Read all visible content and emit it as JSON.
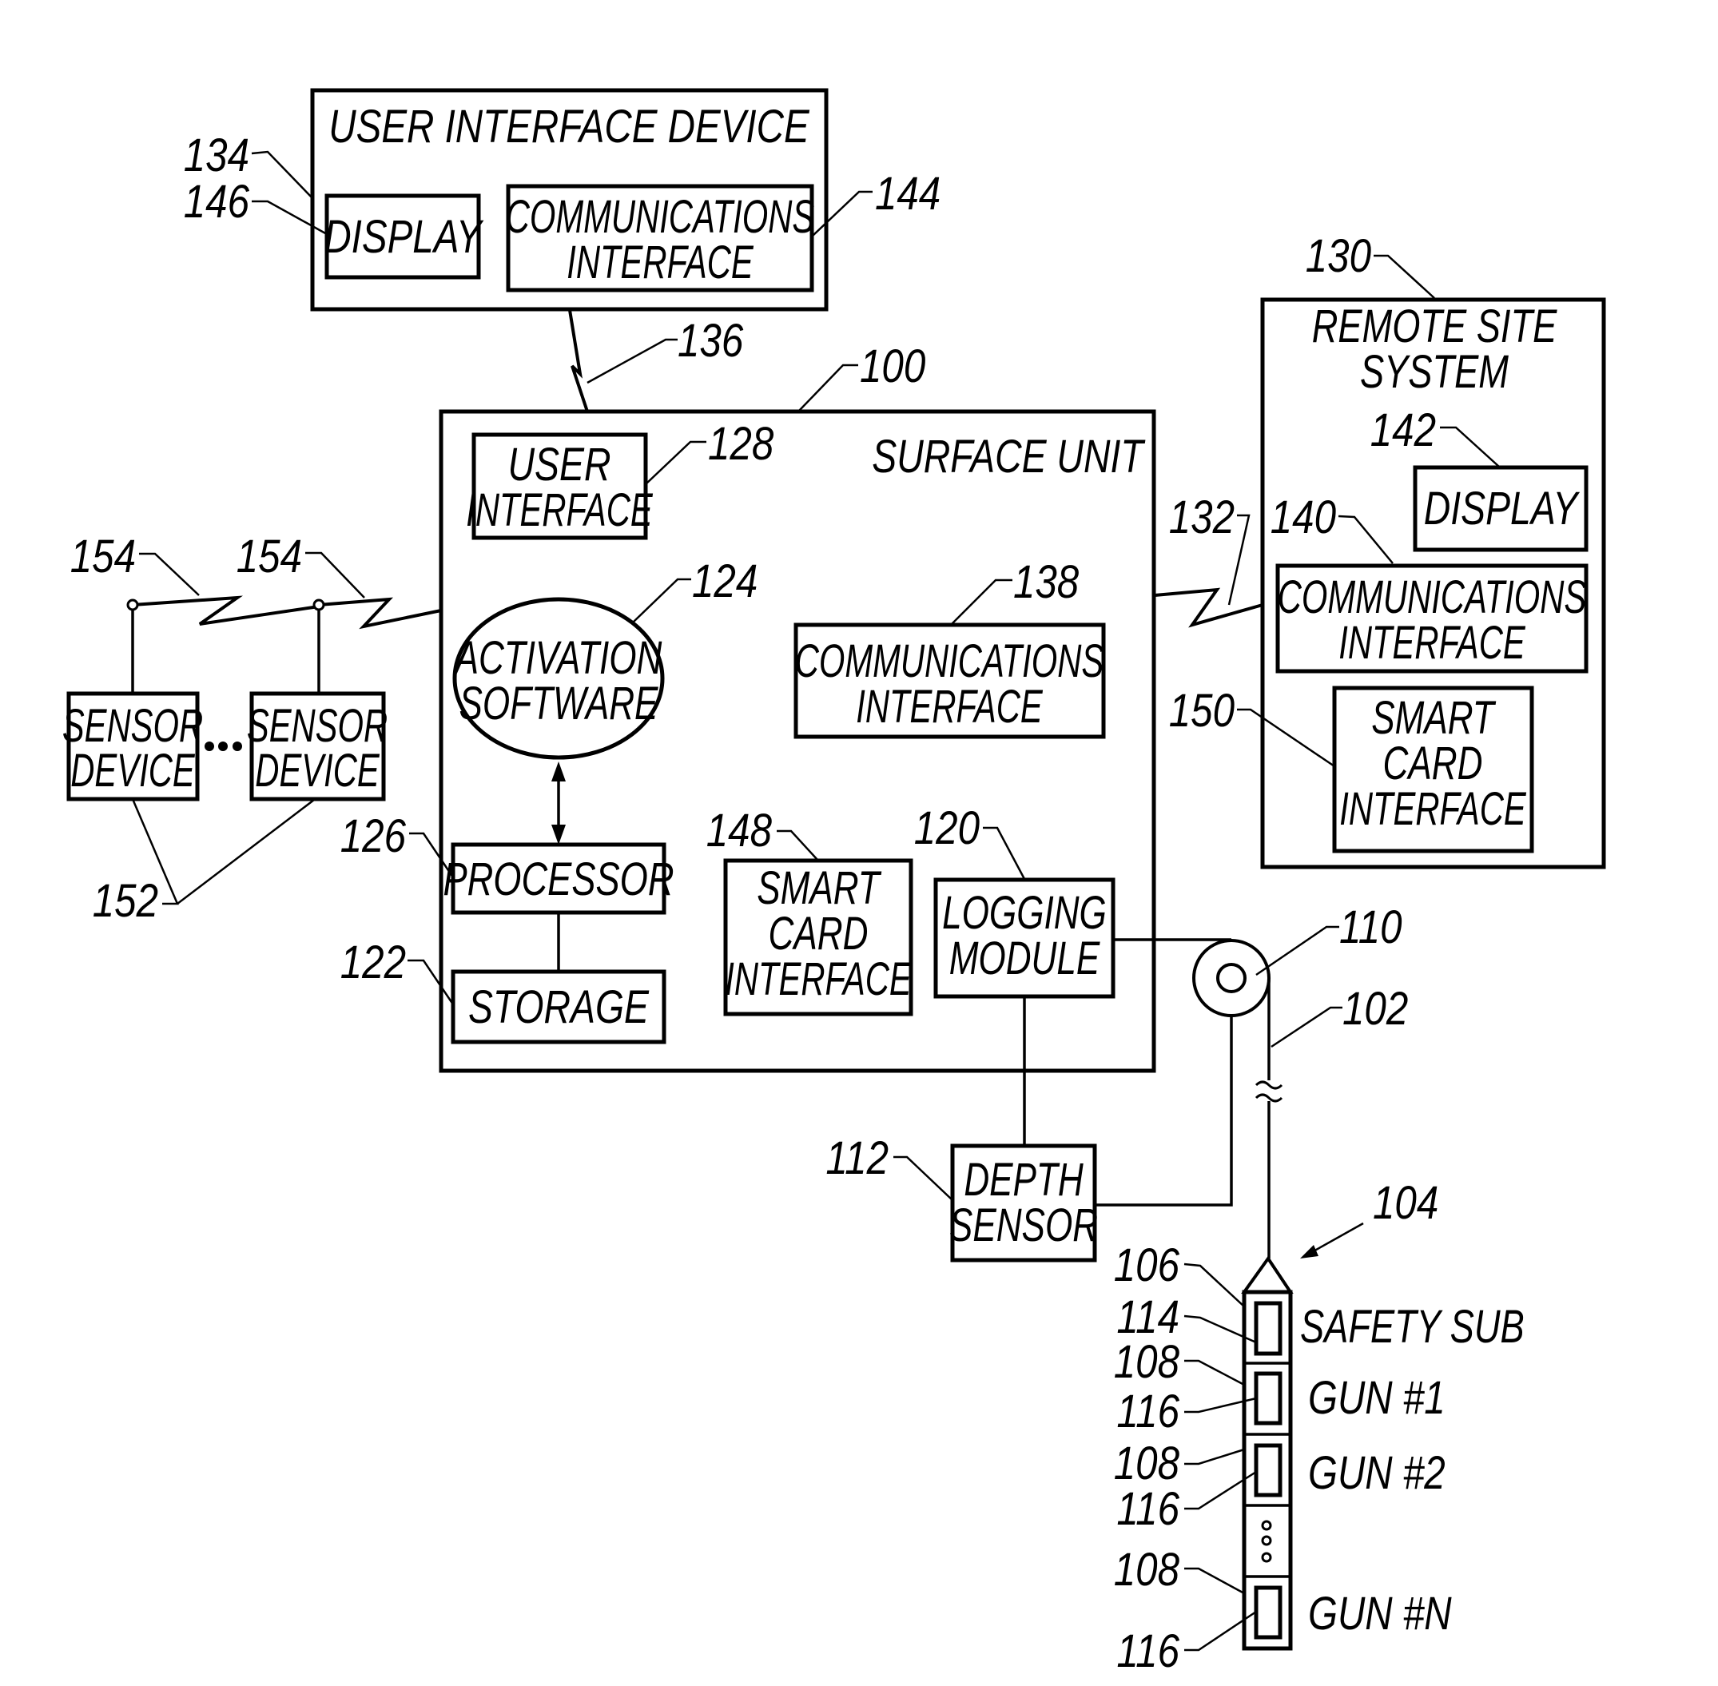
{
  "figure": {
    "user_interface_device": {
      "ref": "134",
      "title": "USER INTERFACE DEVICE",
      "display": {
        "ref": "146",
        "label": "DISPLAY"
      },
      "communications_interface": {
        "ref": "144",
        "line1": "COMMUNICATIONS",
        "line2": "INTERFACE"
      }
    },
    "link_ui_surface": {
      "ref": "136"
    },
    "surface_unit": {
      "ref": "100",
      "title": "SURFACE UNIT",
      "user_interface": {
        "ref": "128",
        "line1": "USER",
        "line2": "INTERFACE"
      },
      "activation_software": {
        "ref": "124",
        "line1": "ACTIVATION",
        "line2": "SOFTWARE"
      },
      "communications_interface": {
        "ref": "138",
        "line1": "COMMUNICATIONS",
        "line2": "INTERFACE"
      },
      "processor": {
        "ref": "126",
        "label": "PROCESSOR"
      },
      "storage": {
        "ref": "122",
        "label": "STORAGE"
      },
      "smart_card_interface": {
        "ref": "148",
        "line1": "SMART",
        "line2": "CARD",
        "line3": "INTERFACE"
      },
      "logging_module": {
        "ref": "120",
        "line1": "LOGGING",
        "line2": "MODULE"
      }
    },
    "link_surface_remote": {
      "ref": "132"
    },
    "remote_site_system": {
      "ref": "130",
      "line1": "REMOTE SITE",
      "line2": "SYSTEM",
      "display": {
        "ref": "142",
        "label": "DISPLAY"
      },
      "communications_interface": {
        "ref": "140",
        "line1": "COMMUNICATIONS",
        "line2": "INTERFACE"
      },
      "smart_card_interface": {
        "ref": "150",
        "line1": "SMART",
        "line2": "CARD",
        "line3": "INTERFACE"
      }
    },
    "sensors": {
      "links_ref": "154",
      "group_ref": "152",
      "device_line1": "SENSOR",
      "device_line2": "DEVICE"
    },
    "pulley": {
      "ref": "110"
    },
    "cable": {
      "ref": "102"
    },
    "depth_sensor": {
      "ref": "112",
      "line1": "DEPTH",
      "line2": "SENSOR"
    },
    "tool_string": {
      "ref": "104",
      "segments": [
        {
          "label": "SAFETY SUB",
          "body_ref": "106",
          "inner_ref": "114"
        },
        {
          "label": "GUN #1",
          "body_ref": "108",
          "inner_ref": "116"
        },
        {
          "label": "GUN #2",
          "body_ref": "108",
          "inner_ref": "116"
        },
        {
          "label": "GUN #N",
          "body_ref": "108",
          "inner_ref": "116"
        }
      ]
    }
  }
}
